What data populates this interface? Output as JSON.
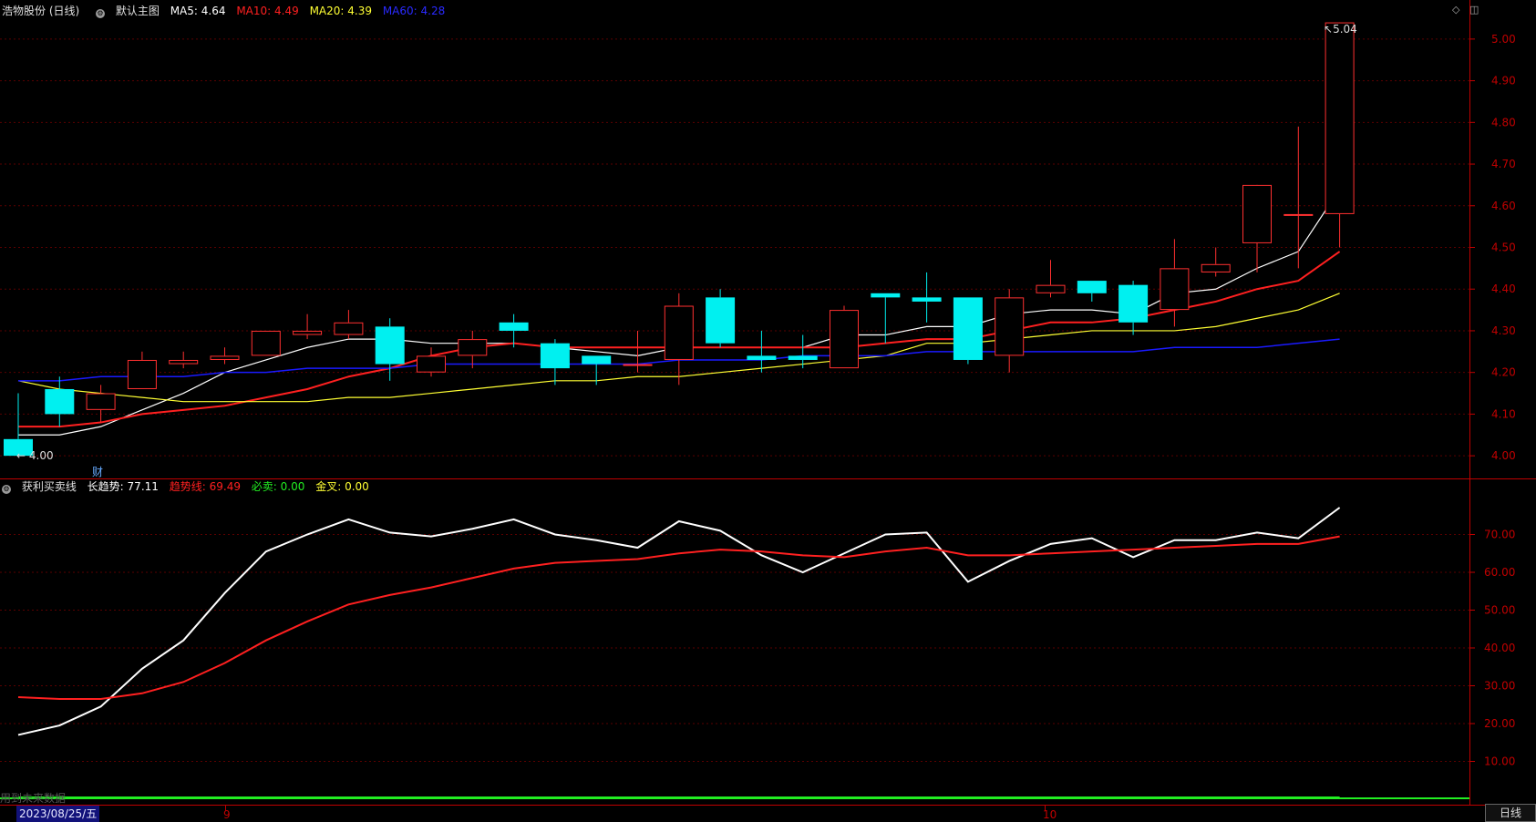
{
  "main_header": {
    "title": "浩物股份 (日线)",
    "chart_name": "默认主图",
    "ma5": {
      "label": "MA5:",
      "value": "4.64",
      "color": "#ffffff"
    },
    "ma10": {
      "label": "MA10:",
      "value": "4.49",
      "color": "#ff2020"
    },
    "ma20": {
      "label": "MA20:",
      "value": "4.39",
      "color": "#ffff33"
    },
    "ma60": {
      "label": "MA60:",
      "value": "4.28",
      "color": "#1a1aff"
    }
  },
  "sub_header": {
    "title": "获利买卖线",
    "long_trend": {
      "label": "长趋势:",
      "value": "77.11",
      "color": "#ffffff"
    },
    "trend_line": {
      "label": "趋势线:",
      "value": "69.49",
      "color": "#ff2020"
    },
    "must_sell": {
      "label": "必卖:",
      "value": "0.00",
      "color": "#22ee22"
    },
    "golden_cross": {
      "label": "金叉:",
      "value": "0.00",
      "color": "#ffff33"
    }
  },
  "markers": {
    "low_label": "4.00",
    "high_label": "5.04",
    "fin_label": "财"
  },
  "x_axis": {
    "date": "2023/08/25/五",
    "month9": "9",
    "month10": "10"
  },
  "ghost_text": "用到未来数据",
  "period_tab": "日线",
  "colors": {
    "up": "#ff3030",
    "down": "#00f0f0",
    "grid": "#5a0000",
    "axis": "#c00000"
  },
  "chart_data": [
    {
      "type": "candlestick",
      "ylim": [
        3.95,
        5.05
      ],
      "yticks": [
        4.0,
        4.1,
        4.2,
        4.3,
        4.4,
        4.5,
        4.6,
        4.7,
        4.8,
        4.9,
        5.0
      ],
      "ohlc": [
        [
          4.04,
          4.15,
          4.0,
          4.0
        ],
        [
          4.16,
          4.19,
          4.07,
          4.1
        ],
        [
          4.11,
          4.17,
          4.08,
          4.15
        ],
        [
          4.16,
          4.25,
          4.16,
          4.23
        ],
        [
          4.22,
          4.25,
          4.21,
          4.23
        ],
        [
          4.23,
          4.26,
          4.22,
          4.24
        ],
        [
          4.24,
          4.3,
          4.24,
          4.3
        ],
        [
          4.29,
          4.34,
          4.28,
          4.3
        ],
        [
          4.29,
          4.35,
          4.28,
          4.32
        ],
        [
          4.31,
          4.33,
          4.18,
          4.22
        ],
        [
          4.2,
          4.26,
          4.19,
          4.24
        ],
        [
          4.24,
          4.3,
          4.21,
          4.28
        ],
        [
          4.32,
          4.34,
          4.26,
          4.3
        ],
        [
          4.27,
          4.28,
          4.17,
          4.21
        ],
        [
          4.24,
          4.24,
          4.17,
          4.22
        ],
        [
          4.22,
          4.3,
          4.2,
          4.22
        ],
        [
          4.23,
          4.39,
          4.17,
          4.36
        ],
        [
          4.38,
          4.4,
          4.26,
          4.27
        ],
        [
          4.24,
          4.3,
          4.2,
          4.23
        ],
        [
          4.24,
          4.29,
          4.21,
          4.23
        ],
        [
          4.21,
          4.36,
          4.21,
          4.35
        ],
        [
          4.39,
          4.39,
          4.27,
          4.38
        ],
        [
          4.38,
          4.44,
          4.32,
          4.37
        ],
        [
          4.38,
          4.38,
          4.22,
          4.23
        ],
        [
          4.24,
          4.4,
          4.2,
          4.38
        ],
        [
          4.39,
          4.47,
          4.38,
          4.41
        ],
        [
          4.42,
          4.42,
          4.37,
          4.39
        ],
        [
          4.41,
          4.42,
          4.29,
          4.32
        ],
        [
          4.35,
          4.52,
          4.31,
          4.45
        ],
        [
          4.44,
          4.5,
          4.43,
          4.46
        ],
        [
          4.51,
          4.59,
          4.44,
          4.65
        ],
        [
          4.58,
          4.79,
          4.45,
          4.58
        ],
        [
          4.58,
          4.6,
          4.5,
          5.04
        ]
      ],
      "series": [
        {
          "name": "MA5",
          "values": [
            4.05,
            4.05,
            4.07,
            4.11,
            4.15,
            4.2,
            4.23,
            4.26,
            4.28,
            4.28,
            4.27,
            4.27,
            4.27,
            4.26,
            4.25,
            4.24,
            4.26,
            4.26,
            4.26,
            4.26,
            4.29,
            4.29,
            4.31,
            4.31,
            4.34,
            4.35,
            4.35,
            4.34,
            4.39,
            4.4,
            4.45,
            4.49,
            4.64
          ]
        },
        {
          "name": "MA10",
          "values": [
            4.07,
            4.07,
            4.08,
            4.1,
            4.11,
            4.12,
            4.14,
            4.16,
            4.19,
            4.21,
            4.24,
            4.26,
            4.27,
            4.26,
            4.26,
            4.26,
            4.26,
            4.26,
            4.26,
            4.26,
            4.26,
            4.27,
            4.28,
            4.28,
            4.3,
            4.32,
            4.32,
            4.33,
            4.35,
            4.37,
            4.4,
            4.42,
            4.49
          ]
        },
        {
          "name": "MA20",
          "values": [
            4.18,
            4.16,
            4.15,
            4.14,
            4.13,
            4.13,
            4.13,
            4.13,
            4.14,
            4.14,
            4.15,
            4.16,
            4.17,
            4.18,
            4.18,
            4.19,
            4.19,
            4.2,
            4.21,
            4.22,
            4.23,
            4.24,
            4.27,
            4.27,
            4.28,
            4.29,
            4.3,
            4.3,
            4.3,
            4.31,
            4.33,
            4.35,
            4.39
          ]
        },
        {
          "name": "MA60",
          "values": [
            4.18,
            4.18,
            4.19,
            4.19,
            4.19,
            4.2,
            4.2,
            4.21,
            4.21,
            4.21,
            4.22,
            4.22,
            4.22,
            4.22,
            4.22,
            4.22,
            4.23,
            4.23,
            4.23,
            4.24,
            4.24,
            4.24,
            4.25,
            4.25,
            4.25,
            4.25,
            4.25,
            4.25,
            4.26,
            4.26,
            4.26,
            4.27,
            4.28
          ]
        }
      ]
    },
    {
      "type": "line",
      "ylim": [
        0,
        80
      ],
      "yticks": [
        10,
        20,
        30,
        40,
        50,
        60,
        70
      ],
      "series": [
        {
          "name": "长趋势",
          "values": [
            17,
            19.5,
            24.5,
            34.5,
            42,
            54.5,
            65.5,
            70,
            74,
            70.5,
            69.5,
            71.5,
            74,
            70,
            68.5,
            66.5,
            73.5,
            71,
            64.5,
            60,
            65,
            70,
            70.5,
            57.5,
            63,
            67.5,
            69,
            64,
            68.5,
            68.5,
            70.5,
            69,
            77.11
          ]
        },
        {
          "name": "趋势线",
          "values": [
            27,
            26.5,
            26.5,
            28,
            31,
            36,
            42,
            47,
            51.5,
            54,
            56,
            58.5,
            61,
            62.5,
            63,
            63.5,
            65,
            66,
            65.5,
            64.5,
            64,
            65.5,
            66.5,
            64.5,
            64.5,
            65,
            65.5,
            66,
            66.5,
            67,
            67.5,
            67.5,
            69.49
          ]
        },
        {
          "name": "必卖",
          "values": [
            0,
            0,
            0,
            0,
            0,
            0,
            0,
            0,
            0,
            0,
            0,
            0,
            0,
            0,
            0,
            0,
            0,
            0,
            0,
            0,
            0,
            0,
            0,
            0,
            0,
            0,
            0,
            0,
            0,
            0,
            0,
            0,
            0
          ]
        }
      ]
    }
  ]
}
